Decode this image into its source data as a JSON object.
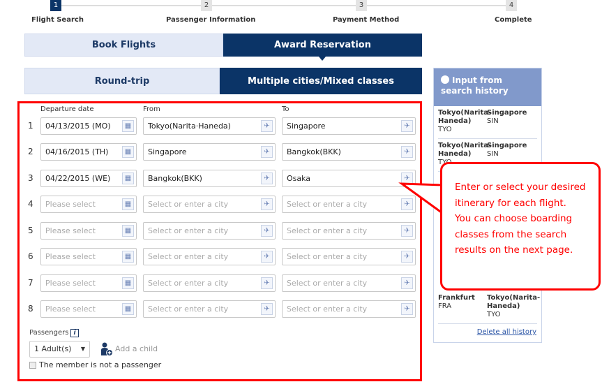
{
  "steps": [
    {
      "num": "1",
      "label": "Flight Search",
      "active": true
    },
    {
      "num": "2",
      "label": "Passenger Information"
    },
    {
      "num": "3",
      "label": "Payment Method"
    },
    {
      "num": "4",
      "label": "Complete"
    }
  ],
  "booking_tabs": {
    "book": "Book Flights",
    "award": "Award Reservation",
    "active": "award"
  },
  "trip_tabs": {
    "round": "Round-trip",
    "multi": "Multiple cities/Mixed classes",
    "active": "multi"
  },
  "columns": {
    "date": "Departure date",
    "from": "From",
    "to": "To"
  },
  "placeholders": {
    "date": "Please select",
    "city": "Select or enter a city"
  },
  "rows": [
    {
      "num": "1",
      "date": "04/13/2015 (MO)",
      "from": "Tokyo(Narita·Haneda)",
      "to": "Singapore"
    },
    {
      "num": "2",
      "date": "04/16/2015 (TH)",
      "from": "Singapore",
      "to": "Bangkok(BKK)"
    },
    {
      "num": "3",
      "date": "04/22/2015 (WE)",
      "from": "Bangkok(BKK)",
      "to": "Osaka"
    },
    {
      "num": "4",
      "date": "",
      "from": "",
      "to": ""
    },
    {
      "num": "5",
      "date": "",
      "from": "",
      "to": ""
    },
    {
      "num": "6",
      "date": "",
      "from": "",
      "to": ""
    },
    {
      "num": "7",
      "date": "",
      "from": "",
      "to": ""
    },
    {
      "num": "8",
      "date": "",
      "from": "",
      "to": ""
    }
  ],
  "passengers": {
    "label": "Passengers",
    "info_icon": "i",
    "select_value": "1 Adult(s)",
    "add_child": "Add a child",
    "member_checkbox": "The member is not a passenger",
    "member_checked": false
  },
  "history": {
    "title": "Input from search history",
    "entries": [
      {
        "from": "Tokyo(Narita-Haneda)",
        "from_code": "TYO",
        "to": "Singapore",
        "to_code": "SIN"
      },
      {
        "from": "Tokyo(Narita-Haneda)",
        "from_code": "TYO",
        "to": "Singapore",
        "to_code": "SIN"
      },
      {
        "from": "Frankfurt",
        "from_code": "FRA",
        "to": "Tokyo(Narita-Haneda)",
        "to_code": "TYO"
      }
    ],
    "delete_all": "Delete all history"
  },
  "callout": {
    "line1": "Enter or select your desired itinerary for each flight.",
    "line2": "You can choose boarding classes from the search results on the next page."
  },
  "colors": {
    "navy": "#0b3467",
    "light_tab": "#e3e9f6",
    "history_header": "#8199cb",
    "annotation": "#ff0000"
  }
}
